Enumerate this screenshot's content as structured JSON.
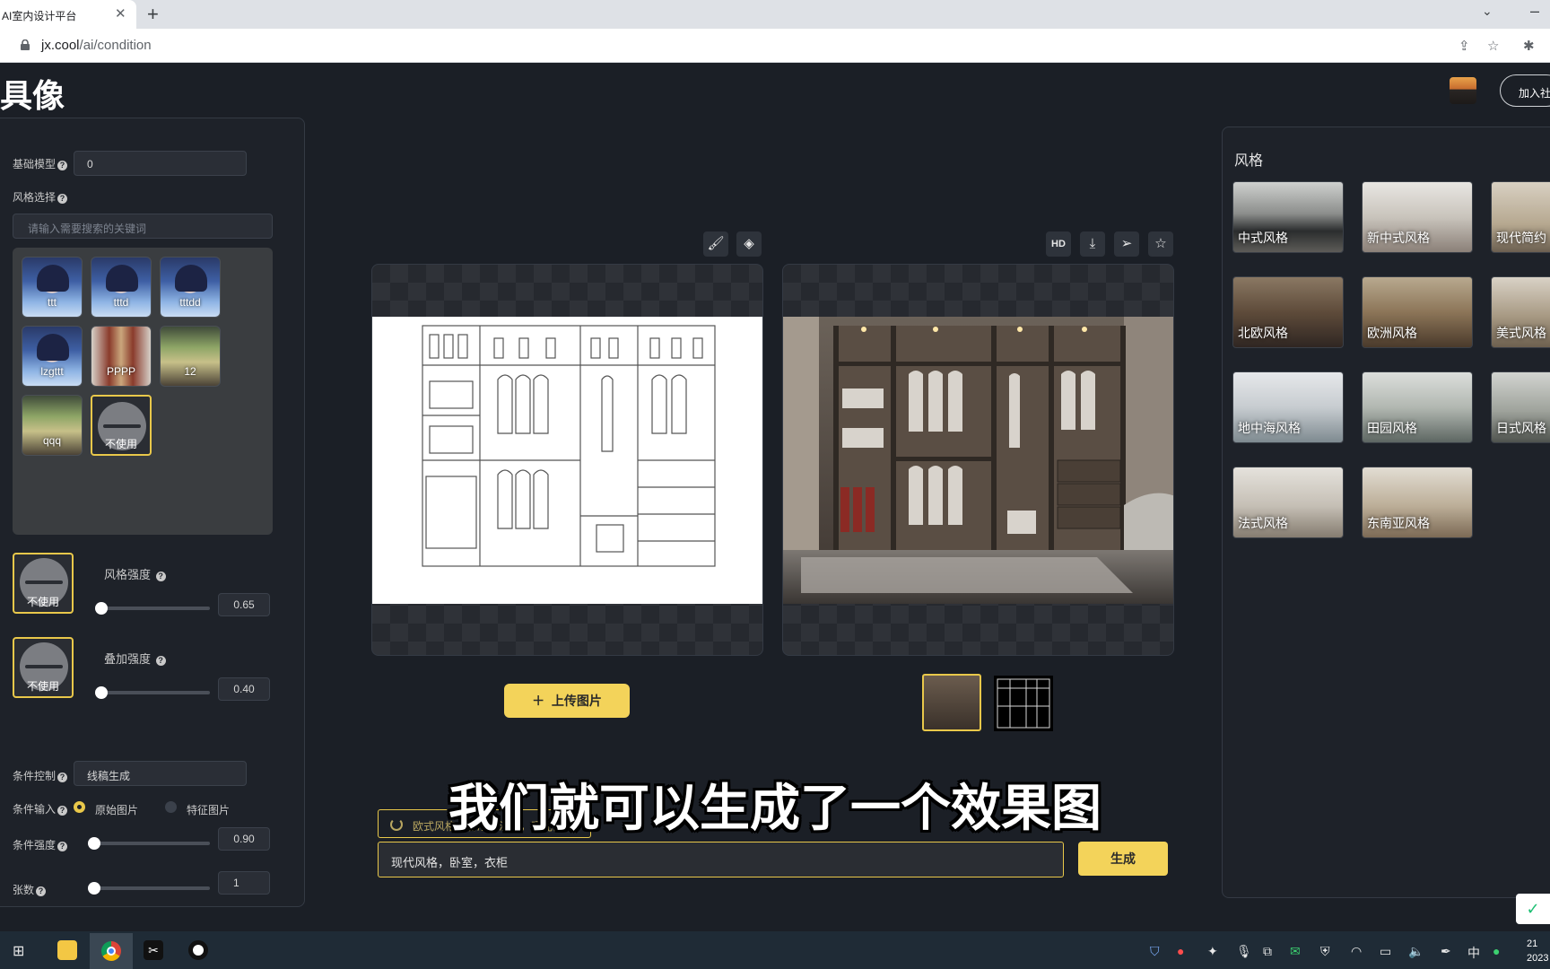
{
  "browser": {
    "tab_title": "AI室内设计平台",
    "tab_close": "✕",
    "new_tab": "+",
    "url_host": "jx.cool",
    "url_path": "/ai/condition"
  },
  "header": {
    "logo": "具像",
    "join_button": "加入社"
  },
  "left_panel": {
    "base_model_label": "基础模型",
    "base_model_value": "0",
    "style_select_label": "风格选择",
    "search_placeholder": "请输入需要搜索的关键词",
    "style_items": [
      {
        "label": "ttt",
        "kind": "anime"
      },
      {
        "label": "tttd",
        "kind": "anime"
      },
      {
        "label": "tttdd",
        "kind": "anime"
      },
      {
        "label": "lzgttt",
        "kind": "anime"
      },
      {
        "label": "PPPP",
        "kind": "room"
      },
      {
        "label": "12",
        "kind": "room"
      },
      {
        "label": "qqq",
        "kind": "room"
      },
      {
        "label": "不使用",
        "kind": "none",
        "selected": true
      }
    ],
    "style_strength": {
      "thumb_label": "不使用",
      "label": "风格强度",
      "value": "0.65",
      "level": 0.0
    },
    "overlay_strength": {
      "thumb_label": "不使用",
      "label": "叠加强度",
      "value": "0.40",
      "level": 0.0
    },
    "condition_control_label": "条件控制",
    "condition_control_value": "线稿生成",
    "condition_input_label": "条件输入",
    "radio_original": "原始图片",
    "radio_feature": "特征图片",
    "condition_strength_label": "条件强度",
    "condition_strength_value": "0.90",
    "count_label": "张数",
    "count_value": "1"
  },
  "canvas": {
    "upload_button": "上传图片",
    "hd_label": "HD"
  },
  "right_panel": {
    "title": "风格",
    "styles": [
      "中式风格",
      "新中式风格",
      "现代简约",
      "北欧风格",
      "欧洲风格",
      "美式风格",
      "地中海风格",
      "田园风格",
      "日式风格",
      "法式风格",
      "东南亚风格"
    ]
  },
  "prompt": {
    "tag": "欧式风格，客厅，沙发，暖光白墙",
    "input_value": "现代风格，卧室，衣柜",
    "generate_button": "生成"
  },
  "subtitle": "我们就可以生成了一个效果图",
  "taskbar": {
    "ime": "中",
    "clock_top": "21",
    "clock_bottom": "2023"
  },
  "colors": {
    "accent": "#f3d35a",
    "background": "#1b1f26",
    "panel": "#1e2229"
  }
}
